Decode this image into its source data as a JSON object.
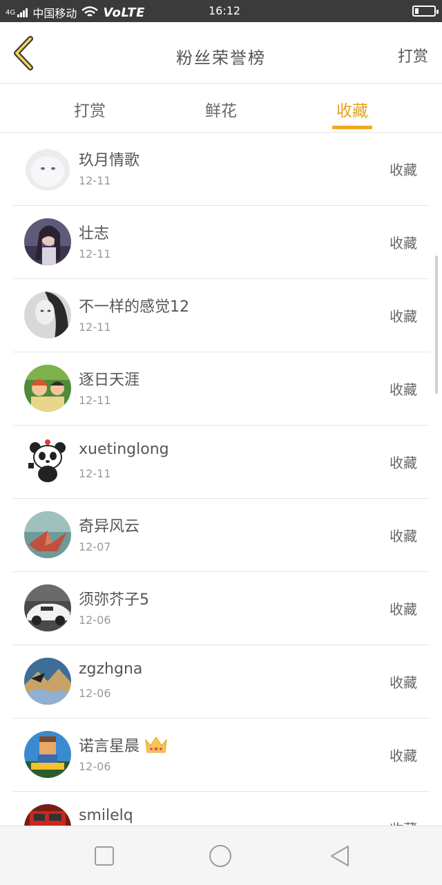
{
  "status_bar": {
    "signal": "4G",
    "carrier": "中国移动",
    "volte": "VoLTE",
    "time": "16:12",
    "battery_level": 0.2
  },
  "header": {
    "title": "粉丝荣誉榜",
    "right_action": "打赏",
    "back_icon": "chevron-left-icon",
    "accent_color": "#f0a71f"
  },
  "tabs": [
    {
      "label": "打赏",
      "active": false
    },
    {
      "label": "鲜花",
      "active": false
    },
    {
      "label": "收藏",
      "active": true
    }
  ],
  "list": [
    {
      "name": "玖月情歌",
      "date": "12-11",
      "action": "收藏",
      "avatar": "white-cat-photo"
    },
    {
      "name": "壮志",
      "date": "12-11",
      "action": "收藏",
      "avatar": "girl-portrait-photo"
    },
    {
      "name": "不一样的感觉12",
      "date": "12-11",
      "action": "收藏",
      "avatar": "woman-monochrome-photo"
    },
    {
      "name": "逐日天涯",
      "date": "12-11",
      "action": "收藏",
      "avatar": "cartoon-kids-photo"
    },
    {
      "name": "xuetinglong",
      "date": "12-11",
      "action": "收藏",
      "avatar": "panda-cartoon"
    },
    {
      "name": "奇异风云",
      "date": "12-07",
      "action": "收藏",
      "avatar": "paper-crane-photo"
    },
    {
      "name": "须弥芥子5",
      "date": "12-06",
      "action": "收藏",
      "avatar": "white-sports-car-photo"
    },
    {
      "name": "zgzhgna",
      "date": "12-06",
      "action": "收藏",
      "avatar": "landscape-photo"
    },
    {
      "name": "诺言星晨",
      "date": "12-06",
      "action": "收藏",
      "avatar": "game-character-photo",
      "badge": "crown-icon"
    },
    {
      "name": "smilelq",
      "date": "",
      "action": "收藏",
      "avatar": "red-truck-photo"
    }
  ],
  "nav_bar": {
    "buttons": [
      "square-icon",
      "circle-icon",
      "triangle-back-icon"
    ]
  }
}
